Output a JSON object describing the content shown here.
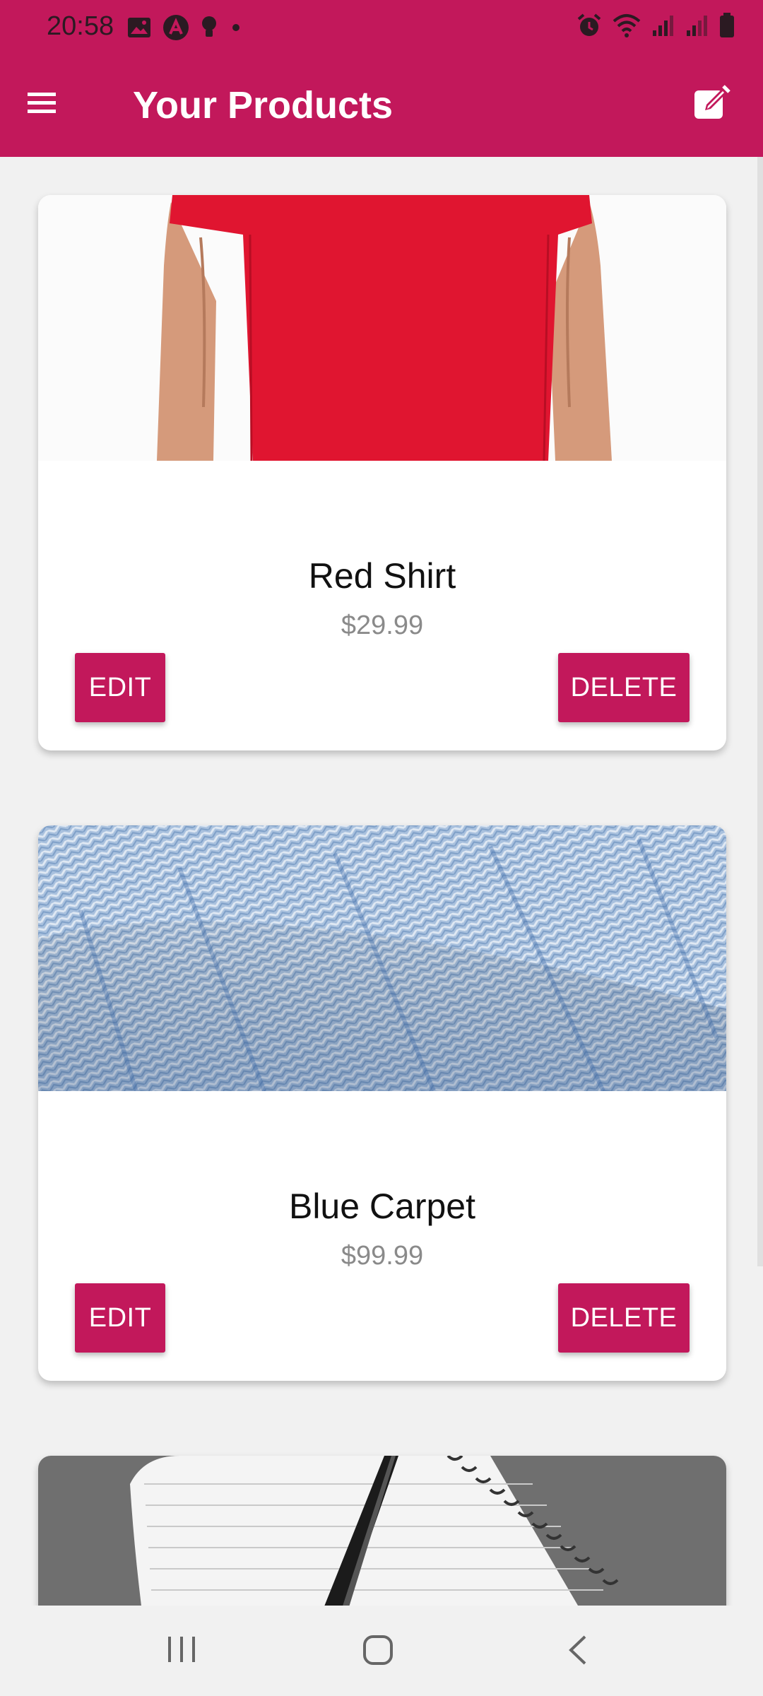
{
  "status_bar": {
    "time": "20:58",
    "left_icons": [
      "image-icon",
      "app-a-icon",
      "bulb-icon",
      "dot-icon"
    ],
    "right_icons": [
      "alarm-icon",
      "wifi-icon",
      "signal-icon",
      "signal-icon",
      "battery-icon"
    ]
  },
  "app_bar": {
    "title": "Your Products",
    "menu_icon": "hamburger-menu-icon",
    "action_icon": "edit-note-icon"
  },
  "colors": {
    "primary": "#c2185b",
    "background": "#f1f1f1",
    "card": "#ffffff",
    "price_text": "#8a8a8a"
  },
  "products": [
    {
      "name": "Red Shirt",
      "price": "$29.99",
      "image": "red-shirt-image",
      "edit_label": "EDIT",
      "delete_label": "DELETE"
    },
    {
      "name": "Blue Carpet",
      "price": "$99.99",
      "image": "blue-carpet-image",
      "edit_label": "EDIT",
      "delete_label": "DELETE"
    },
    {
      "name": "",
      "price": "",
      "image": "notebook-pen-image",
      "edit_label": "",
      "delete_label": ""
    }
  ],
  "nav_bar": {
    "icons": [
      "recents-icon",
      "home-icon",
      "back-icon"
    ]
  }
}
